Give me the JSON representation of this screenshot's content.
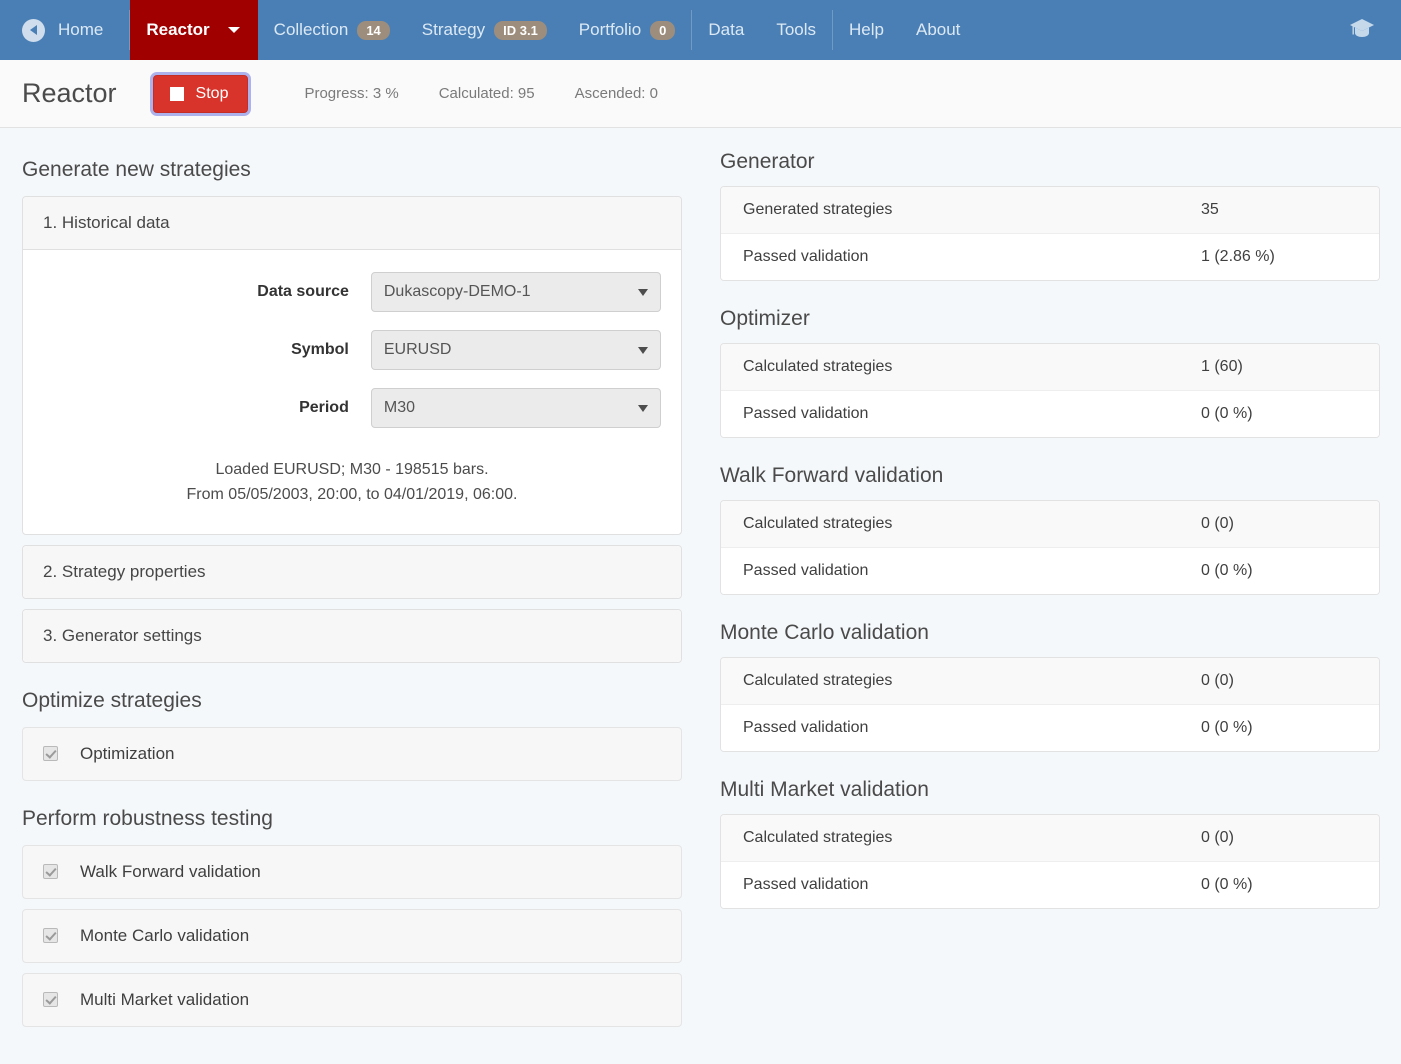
{
  "navbar": {
    "back_icon": "back-arrow-icon",
    "home_label": "Home",
    "active_tab": "Reactor",
    "items": [
      {
        "label": "Collection",
        "badge": "14"
      },
      {
        "label": "Strategy",
        "badge": "ID 3.1"
      },
      {
        "label": "Portfolio",
        "badge": "0"
      }
    ],
    "data_label": "Data",
    "tools_label": "Tools",
    "help_label": "Help",
    "about_label": "About",
    "right_icon": "graduation-cap-icon",
    "colors": {
      "navbar_bg": "#4a7fb5",
      "active_tab_bg": "#a00000",
      "badge_bg": "#9d8d7c"
    }
  },
  "toolbar": {
    "title": "Reactor",
    "stop_label": "Stop",
    "stop_color": "#d9342b",
    "progress": "Progress: 3 %",
    "calculated": "Calculated: 95",
    "ascended": "Ascended: 0"
  },
  "left": {
    "generate_title": "Generate new strategies",
    "panel1_title": "1. Historical data",
    "fields": [
      {
        "label": "Data source",
        "value": "Dukascopy-DEMO-1"
      },
      {
        "label": "Symbol",
        "value": "EURUSD"
      },
      {
        "label": "Period",
        "value": "M30"
      }
    ],
    "loaded_line1": "Loaded EURUSD; M30 - 198515 bars.",
    "loaded_line2": "From 05/05/2003, 20:00, to 04/01/2019, 06:00.",
    "panel2_title": "2. Strategy properties",
    "panel3_title": "3. Generator settings",
    "optimize_title": "Optimize strategies",
    "optimize_items": [
      {
        "label": "Optimization",
        "checked": true
      }
    ],
    "robustness_title": "Perform robustness testing",
    "robustness_items": [
      {
        "label": "Walk Forward validation",
        "checked": true
      },
      {
        "label": "Monte Carlo validation",
        "checked": true
      },
      {
        "label": "Multi Market validation",
        "checked": true
      }
    ]
  },
  "right": {
    "blocks": [
      {
        "title": "Generator",
        "rows": [
          {
            "key": "Generated strategies",
            "value": "35"
          },
          {
            "key": "Passed validation",
            "value": "1 (2.86 %)"
          }
        ]
      },
      {
        "title": "Optimizer",
        "rows": [
          {
            "key": "Calculated strategies",
            "value": "1 (60)"
          },
          {
            "key": "Passed validation",
            "value": "0 (0 %)"
          }
        ]
      },
      {
        "title": "Walk Forward validation",
        "rows": [
          {
            "key": "Calculated strategies",
            "value": "0 (0)"
          },
          {
            "key": "Passed validation",
            "value": "0 (0 %)"
          }
        ]
      },
      {
        "title": "Monte Carlo validation",
        "rows": [
          {
            "key": "Calculated strategies",
            "value": "0 (0)"
          },
          {
            "key": "Passed validation",
            "value": "0 (0 %)"
          }
        ]
      },
      {
        "title": "Multi Market validation",
        "rows": [
          {
            "key": "Calculated strategies",
            "value": "0 (0)"
          },
          {
            "key": "Passed validation",
            "value": "0 (0 %)"
          }
        ]
      }
    ]
  }
}
